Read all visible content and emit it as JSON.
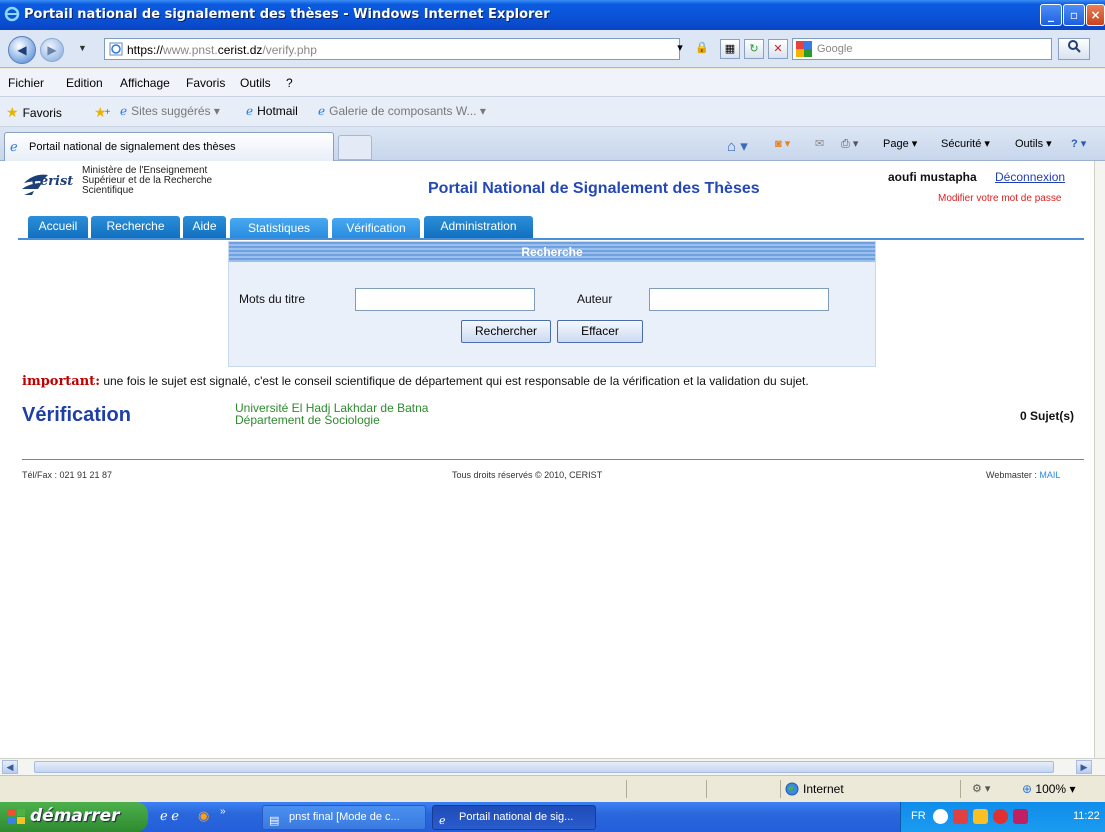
{
  "window": {
    "title": "Portail national de signalement des thèses - Windows Internet Explorer"
  },
  "address": {
    "protocol": "https://",
    "host_prefix": "www.pnst.",
    "host_main": "cerist.dz",
    "path": "/verify.php",
    "search_placeholder": "Google"
  },
  "menu": [
    "Fichier",
    "Edition",
    "Affichage",
    "Favoris",
    "Outils",
    "?"
  ],
  "favorites": {
    "label": "Favoris",
    "items": [
      "Sites suggérés ▾",
      "Hotmail",
      "Galerie de composants W... ▾"
    ]
  },
  "tab": {
    "title": "Portail national de signalement des thèses"
  },
  "commandbar": {
    "page": "Page ▾",
    "security": "Sécurité ▾",
    "tools": "Outils ▾"
  },
  "site": {
    "logo": "cerist",
    "ministry": [
      "Ministère de l'Enseignement",
      "Supérieur et de la Recherche",
      "Scientifique"
    ],
    "title": "Portail National de Signalement des Thèses",
    "user": "aoufi mustapha",
    "logout": "Déconnexion",
    "change_password": "Modifier votre mot de passe",
    "nav": [
      "Accueil",
      "Recherche",
      "Aide",
      "Statistiques",
      "Vérification",
      "Administration"
    ]
  },
  "search": {
    "heading": "Recherche",
    "title_label": "Mots du titre",
    "title_value": "",
    "author_label": "Auteur",
    "author_value": "",
    "search_button": "Rechercher",
    "clear_button": "Effacer"
  },
  "notice": {
    "label": "important:",
    "text": " une fois le sujet est signalé, c'est le conseil scientifique de département qui est responsable de la vérification et la validation du sujet."
  },
  "verification": {
    "title": "Vérification",
    "university": "Université El Hadj Lakhdar de Batna",
    "department": "Département de Sociologie",
    "count": "0 Sujet(s)"
  },
  "footer": {
    "phone": "Tél/Fax : 021 91 21 87",
    "copyright": "Tous droits réservés © 2010, CERIST",
    "webmaster": "Webmaster : ",
    "mail": "MAIL"
  },
  "status": {
    "zone": "Internet",
    "zoom": "100%"
  },
  "taskbar": {
    "start": "démarrer",
    "items": [
      "pnst final [Mode de c...",
      "Portail national de sig..."
    ],
    "lang": "FR",
    "clock": "11:22"
  }
}
